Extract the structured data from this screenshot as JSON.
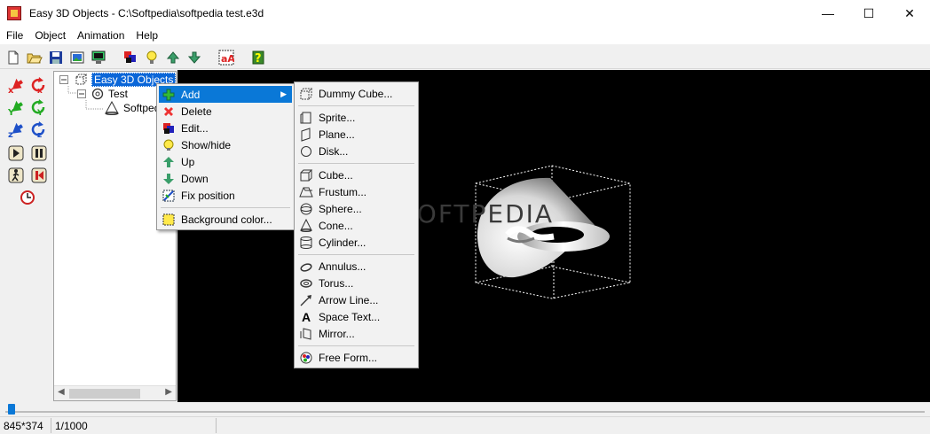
{
  "window": {
    "title": "Easy 3D Objects - C:\\Softpedia\\softpedia test.e3d",
    "minimize": "—",
    "maximize": "☐",
    "close": "✕"
  },
  "menubar": [
    "File",
    "Object",
    "Animation",
    "Help"
  ],
  "toolbar_icons": [
    "new-icon",
    "open-icon",
    "save-icon",
    "export-image-icon",
    "render-icon",
    "colors-icon",
    "light-icon",
    "up-icon",
    "down-icon",
    "text-icon",
    "help-icon"
  ],
  "leftbar_icons": [
    "move-x-icon",
    "rotate-x-icon",
    "move-y-icon",
    "rotate-y-icon",
    "move-z-icon",
    "rotate-z-icon",
    "play-icon",
    "pause-icon",
    "walk-icon",
    "record-icon",
    "clock-icon"
  ],
  "tree": {
    "root": "Easy 3D Objects",
    "child": "Test",
    "grandchild": "Softpedia"
  },
  "context_menu": [
    {
      "label": "Add",
      "icon": "plus-icon",
      "highlighted": true,
      "submenu": true
    },
    {
      "label": "Delete",
      "icon": "delete-icon"
    },
    {
      "label": "Edit...",
      "icon": "edit-icon"
    },
    {
      "label": "Show/hide",
      "icon": "bulb-icon"
    },
    {
      "label": "Up",
      "icon": "up-icon"
    },
    {
      "label": "Down",
      "icon": "down-icon"
    },
    {
      "label": "Fix position",
      "icon": "fix-position-icon"
    },
    {
      "label": "Background color...",
      "icon": "background-color-icon"
    }
  ],
  "submenu": {
    "group1": [
      {
        "label": "Dummy Cube...",
        "icon": "dummy-cube-icon"
      }
    ],
    "group2": [
      {
        "label": "Sprite...",
        "icon": "sprite-icon"
      },
      {
        "label": "Plane...",
        "icon": "plane-icon"
      },
      {
        "label": "Disk...",
        "icon": "disk-icon"
      }
    ],
    "group3": [
      {
        "label": "Cube...",
        "icon": "cube-icon"
      },
      {
        "label": "Frustum...",
        "icon": "frustum-icon"
      },
      {
        "label": "Sphere...",
        "icon": "sphere-icon"
      },
      {
        "label": "Cone...",
        "icon": "cone-icon"
      },
      {
        "label": "Cylinder...",
        "icon": "cylinder-icon"
      }
    ],
    "group4": [
      {
        "label": "Annulus...",
        "icon": "annulus-icon"
      },
      {
        "label": "Torus...",
        "icon": "torus-icon"
      },
      {
        "label": "Arrow Line...",
        "icon": "arrow-line-icon"
      },
      {
        "label": "Space Text...",
        "icon": "space-text-icon"
      },
      {
        "label": "Mirror...",
        "icon": "mirror-icon"
      }
    ],
    "group5": [
      {
        "label": "Free Form...",
        "icon": "free-form-icon"
      }
    ]
  },
  "viewport": {
    "watermark": "SOFTPEDIA",
    "background": "#000000"
  },
  "animation_slider": {
    "position": 0.001
  },
  "status": {
    "dimensions": "845*374",
    "frame": "1/1000"
  }
}
